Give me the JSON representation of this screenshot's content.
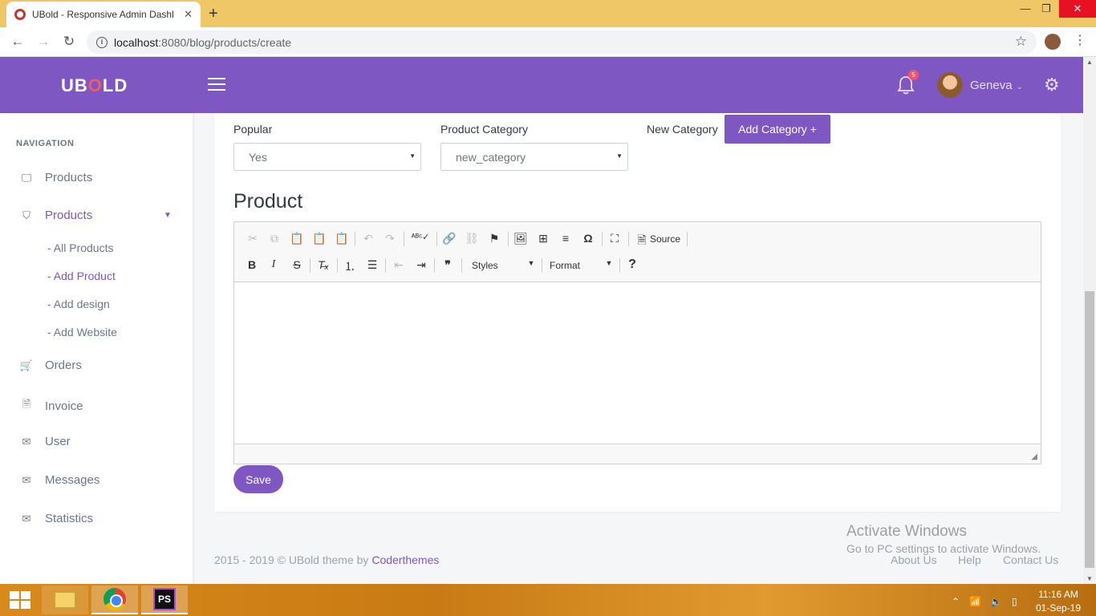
{
  "browser": {
    "tab_title": "UBold - Responsive Admin Dashl",
    "tab_close": "✕",
    "new_tab": "+",
    "url_host": "localhost",
    "url_path": ":8080/blog/products/create",
    "win_min": "—",
    "win_restore": "❐",
    "win_close": "✕"
  },
  "header": {
    "logo_pre": "UB",
    "logo_o": "O",
    "logo_post": "LD",
    "notification_count": "5",
    "user_name": "Geneva"
  },
  "sidebar": {
    "title": "NAVIGATION",
    "items": [
      {
        "label": "Products",
        "icon": "monitor-icon"
      },
      {
        "label": "Products",
        "icon": "shield-icon"
      },
      {
        "label": "Orders",
        "icon": "cart-icon"
      },
      {
        "label": "Invoice",
        "icon": "file-icon"
      },
      {
        "label": "User",
        "icon": "mail-icon"
      },
      {
        "label": "Messages",
        "icon": "mail-icon"
      },
      {
        "label": "Statistics",
        "icon": "mail-icon"
      }
    ],
    "subitems": [
      {
        "label": "- All Products"
      },
      {
        "label": "- Add Product"
      },
      {
        "label": "- Add design"
      },
      {
        "label": "- Add Website"
      }
    ]
  },
  "form": {
    "popular_label": "Popular",
    "popular_value": "Yes",
    "category_label": "Product Category",
    "category_value": "new_category",
    "new_category_label": "New Category",
    "add_category_button": "Add Category +",
    "product_heading": "Product",
    "save_button": "Save"
  },
  "editor": {
    "source_label": "Source",
    "styles_label": "Styles",
    "format_label": "Format",
    "help_label": "?"
  },
  "footer": {
    "copyright": "2015 - 2019 © UBold theme by ",
    "brand": "Coderthemes",
    "links": [
      "About Us",
      "Help",
      "Contact Us"
    ]
  },
  "watermark": {
    "line1": "Activate Windows",
    "line2": "Go to PC settings to activate Windows."
  },
  "taskbar": {
    "ps_label": "PS",
    "time": "11:16 AM",
    "date": "01-Sep-19"
  }
}
